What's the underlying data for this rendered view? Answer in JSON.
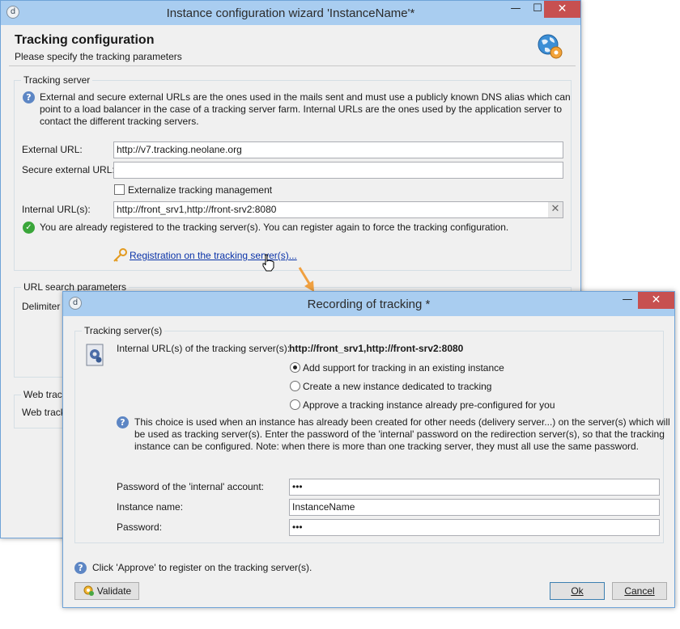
{
  "main_window": {
    "title": "Instance configuration wizard 'InstanceName'*",
    "minimize_glyph": "—",
    "maximize_glyph": "☐",
    "close_glyph": "✕",
    "header_title": "Tracking configuration",
    "header_subtitle": "Please specify the tracking parameters",
    "tracking_server": {
      "group_label": "Tracking server",
      "help_text_line1": "External and secure external URLs are the ones used in the mails sent and must use a publicly known DNS alias which can",
      "help_text_line2": "point to a load balancer in the case of a tracking server farm. Internal URLs are the ones used by the application server to",
      "help_text_line3": "contact the different tracking servers.",
      "external_url_label": "External URL:",
      "external_url_value": "http://v7.tracking.neolane.org",
      "secure_external_url_label": "Secure external URL:",
      "secure_external_url_value": "",
      "externalize_label": "Externalize tracking management",
      "internal_urls_label": "Internal URL(s):",
      "internal_urls_value": "http://front_srv1,http://front-srv2:8080",
      "status_text": "You are already registered to the tracking server(s). You can register again to force the tracking configuration.",
      "registration_link": "Registration on the tracking server(s)..."
    },
    "url_search": {
      "group_label": "URL search parameters",
      "delimiter_label": "Delimiter"
    },
    "web_tracking": {
      "group_label": "Web track",
      "row_label": "Web track"
    }
  },
  "dialog": {
    "title": "Recording of tracking *",
    "minimize_glyph": "—",
    "close_glyph": "✕",
    "group_label": "Tracking server(s)",
    "internal_urls_label": "Internal URL(s) of the tracking server(s):",
    "internal_urls_value": "http://front_srv1,http://front-srv2:8080",
    "options": [
      {
        "label": "Add support for tracking in an existing instance",
        "selected": true
      },
      {
        "label": "Create a new instance dedicated to tracking",
        "selected": false
      },
      {
        "label": "Approve a tracking instance already pre-configured for you",
        "selected": false
      }
    ],
    "help_line1": "This choice is used when an instance has already been created for other needs (delivery server...) on the server(s) which will",
    "help_line2": "be used as tracking server(s). Enter the password of the 'internal' password on the redirection server(s), so that the tracking",
    "help_line3": "instance can be configured. Note: when there is more than one tracking server, they must all use the same password.",
    "password_internal_label": "Password of the 'internal' account:",
    "password_internal_value": "•••",
    "instance_name_label": "Instance name:",
    "instance_name_value": "InstanceName",
    "password_label": "Password:",
    "password_value": "•••",
    "footer_help": "Click 'Approve' to register on the tracking server(s).",
    "validate_button": "Validate",
    "ok_button": "Ok",
    "cancel_button": "Cancel"
  },
  "colors": {
    "titlebar": "#a9cdf0",
    "close_button": "#c75050",
    "link": "#0a33a8",
    "accent_arrow": "#f0a040"
  }
}
